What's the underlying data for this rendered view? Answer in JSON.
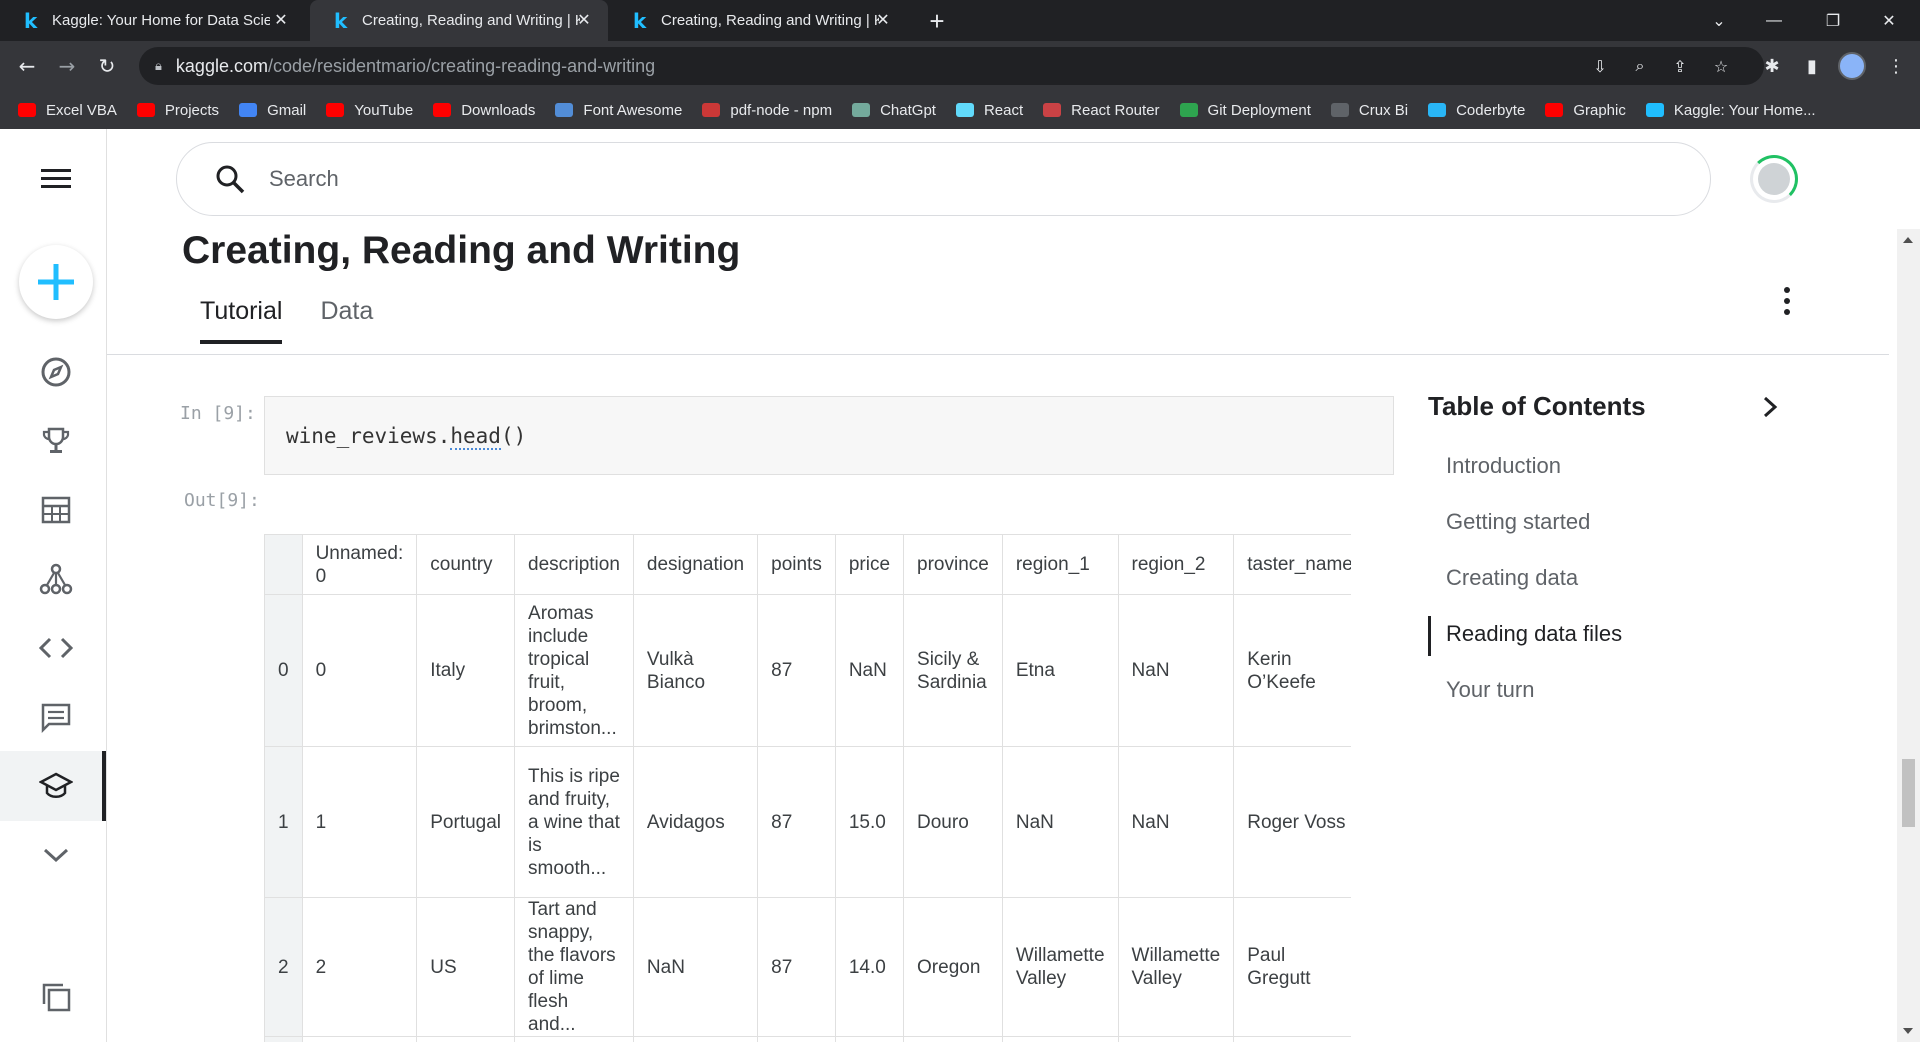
{
  "browser": {
    "tabs": [
      {
        "title": "Kaggle: Your Home for Data Science"
      },
      {
        "title": "Creating, Reading and Writing | Kaggle"
      },
      {
        "title": "Creating, Reading and Writing | Kaggle"
      }
    ],
    "url_host": "kaggle.com",
    "url_path": "/code/residentmario/creating-reading-and-writing",
    "bookmarks": [
      {
        "label": "Excel VBA",
        "color": "#ff0000"
      },
      {
        "label": "Projects",
        "color": "#ff0000"
      },
      {
        "label": "Gmail",
        "color": "#4285f4"
      },
      {
        "label": "YouTube",
        "color": "#ff0000"
      },
      {
        "label": "Downloads",
        "color": "#ff0000"
      },
      {
        "label": "Font Awesome",
        "color": "#528dd7"
      },
      {
        "label": "pdf-node - npm",
        "color": "#cb3837"
      },
      {
        "label": "ChatGpt",
        "color": "#74aa9c"
      },
      {
        "label": "React",
        "color": "#61dafb"
      },
      {
        "label": "React Router",
        "color": "#ca4245"
      },
      {
        "label": "Git Deployment",
        "color": "#2ea44f"
      },
      {
        "label": "Crux Bi",
        "color": "#5f6368"
      },
      {
        "label": "Coderbyte",
        "color": "#29b6f6"
      },
      {
        "label": "Graphic",
        "color": "#ff0000"
      },
      {
        "label": "Kaggle: Your Home...",
        "color": "#20beff"
      }
    ]
  },
  "search": {
    "placeholder": "Search"
  },
  "page": {
    "title": "Creating, Reading and Writing",
    "tabs": [
      {
        "label": "Tutorial"
      },
      {
        "label": "Data"
      }
    ]
  },
  "notebook": {
    "in_prompt": "In [9]:",
    "code_obj": "wine_reviews",
    "code_dot": ".",
    "code_fn": "head",
    "code_parens": "()",
    "out_prompt": "Out[9]:",
    "table": {
      "headers": [
        "",
        "Unnamed: 0",
        "country",
        "description",
        "designation",
        "points",
        "price",
        "province",
        "region_1",
        "region_2",
        "taster_name"
      ],
      "rows": [
        [
          "0",
          "0",
          "Italy",
          "Aromas include tropical fruit, broom, brimston...",
          "Vulkà Bianco",
          "87",
          "NaN",
          "Sicily & Sardinia",
          "Etna",
          "NaN",
          "Kerin O’Keefe"
        ],
        [
          "1",
          "1",
          "Portugal",
          "This is ripe and fruity, a wine that is smooth...",
          "Avidagos",
          "87",
          "15.0",
          "Douro",
          "NaN",
          "NaN",
          "Roger Voss"
        ],
        [
          "2",
          "2",
          "US",
          "Tart and snappy, the flavors of lime flesh and...",
          "NaN",
          "87",
          "14.0",
          "Oregon",
          "Willamette Valley",
          "Willamette Valley",
          "Paul Gregutt"
        ],
        [
          "",
          "",
          "",
          "",
          "",
          "",
          "",
          "",
          "",
          "",
          ""
        ]
      ]
    }
  },
  "toc": {
    "title": "Table of Contents",
    "items": [
      {
        "label": "Introduction"
      },
      {
        "label": "Getting started"
      },
      {
        "label": "Creating data"
      },
      {
        "label": "Reading data files"
      },
      {
        "label": "Your turn"
      }
    ],
    "active_index": 3
  },
  "colors": {
    "kaggle_blue": "#20beff",
    "progress_green": "#20c163"
  }
}
